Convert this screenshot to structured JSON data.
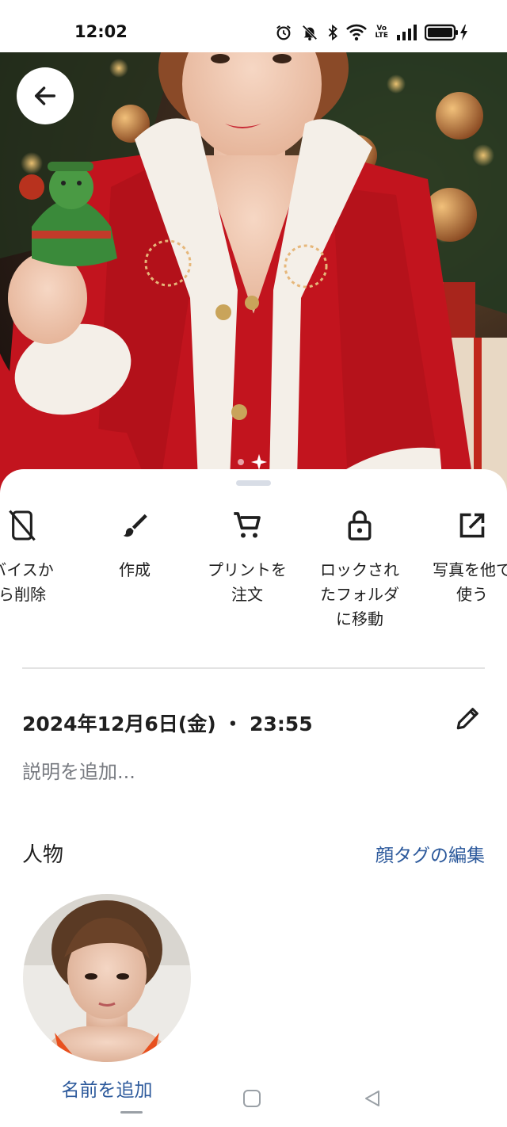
{
  "status_bar": {
    "time": "12:02",
    "icons": [
      "alarm-icon",
      "mute-icon",
      "bluetooth-icon",
      "wifi-icon",
      "volte-icon",
      "signal-icon",
      "battery-charging-icon"
    ],
    "volte_top": "Vo",
    "volte_bottom": "LTE"
  },
  "photo": {
    "back_icon": "arrow-back-icon",
    "indicator_icon": "sparkle-icon"
  },
  "actions": [
    {
      "icon": "phone-off-icon",
      "label": "デバイスから削除"
    },
    {
      "icon": "brush-icon",
      "label": "作成"
    },
    {
      "icon": "cart-icon",
      "label": "プリントを\n注文"
    },
    {
      "icon": "lock-icon",
      "label": "ロックされ\nたフォルダ\nに移動"
    },
    {
      "icon": "open-external-icon",
      "label": "写真を他で\n使う"
    }
  ],
  "action_labels": {
    "remove_from_device": "バイスか\nら削除",
    "create": "作成",
    "order_prints": "プリントを\n注文",
    "move_to_locked": "ロックされ\nたフォルダ\nに移動",
    "use_elsewhere": "写真を他で\n使う"
  },
  "details": {
    "datetime": "2024年12月6日(金) ・ 23:55",
    "edit_icon": "pencil-icon",
    "description_placeholder": "説明を追加..."
  },
  "people": {
    "title": "人物",
    "edit_face_tags": "顔タグの編集",
    "add_name": "名前を追加"
  },
  "navigation": {
    "items": [
      "recents-icon",
      "home-icon",
      "back-icon"
    ]
  },
  "colors": {
    "link": "#2d5a9c",
    "text": "#1f1f1f",
    "secondary_text": "#777a80",
    "sheet_handle": "#d8dde6"
  }
}
